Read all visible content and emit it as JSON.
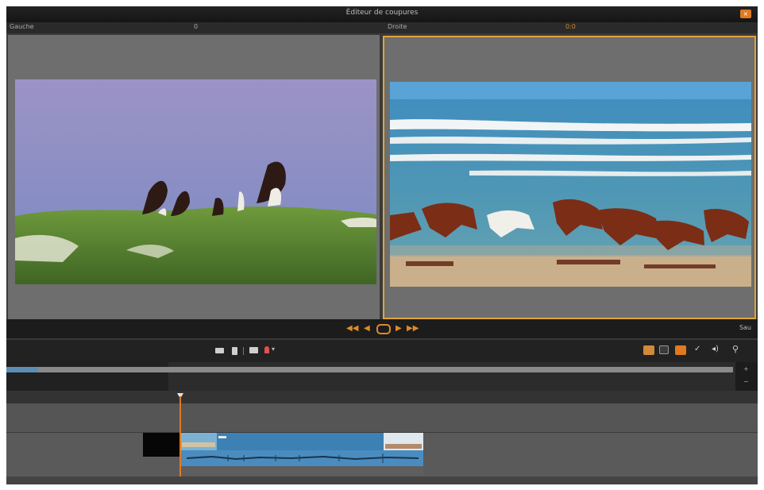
{
  "window": {
    "title": "Éditeur de coupures",
    "close_label": "×"
  },
  "monitors": {
    "left_label": "Gauche",
    "left_marker": "0",
    "right_label": "Droite",
    "right_marker": "0:0"
  },
  "transport": {
    "right_label": "Sau"
  },
  "colors": {
    "accent": "#e0a53a",
    "playhead": "#e07a1f",
    "window_bg": "#3a3a3a"
  },
  "icons": [
    "prev-frame-icon",
    "step-back-icon",
    "loop-icon",
    "step-forward-icon",
    "next-frame-icon",
    "film-icon",
    "trash-icon",
    "clip-icon",
    "marker-icon",
    "lock-icon",
    "magnet-icon",
    "volume-icon",
    "search-icon"
  ]
}
